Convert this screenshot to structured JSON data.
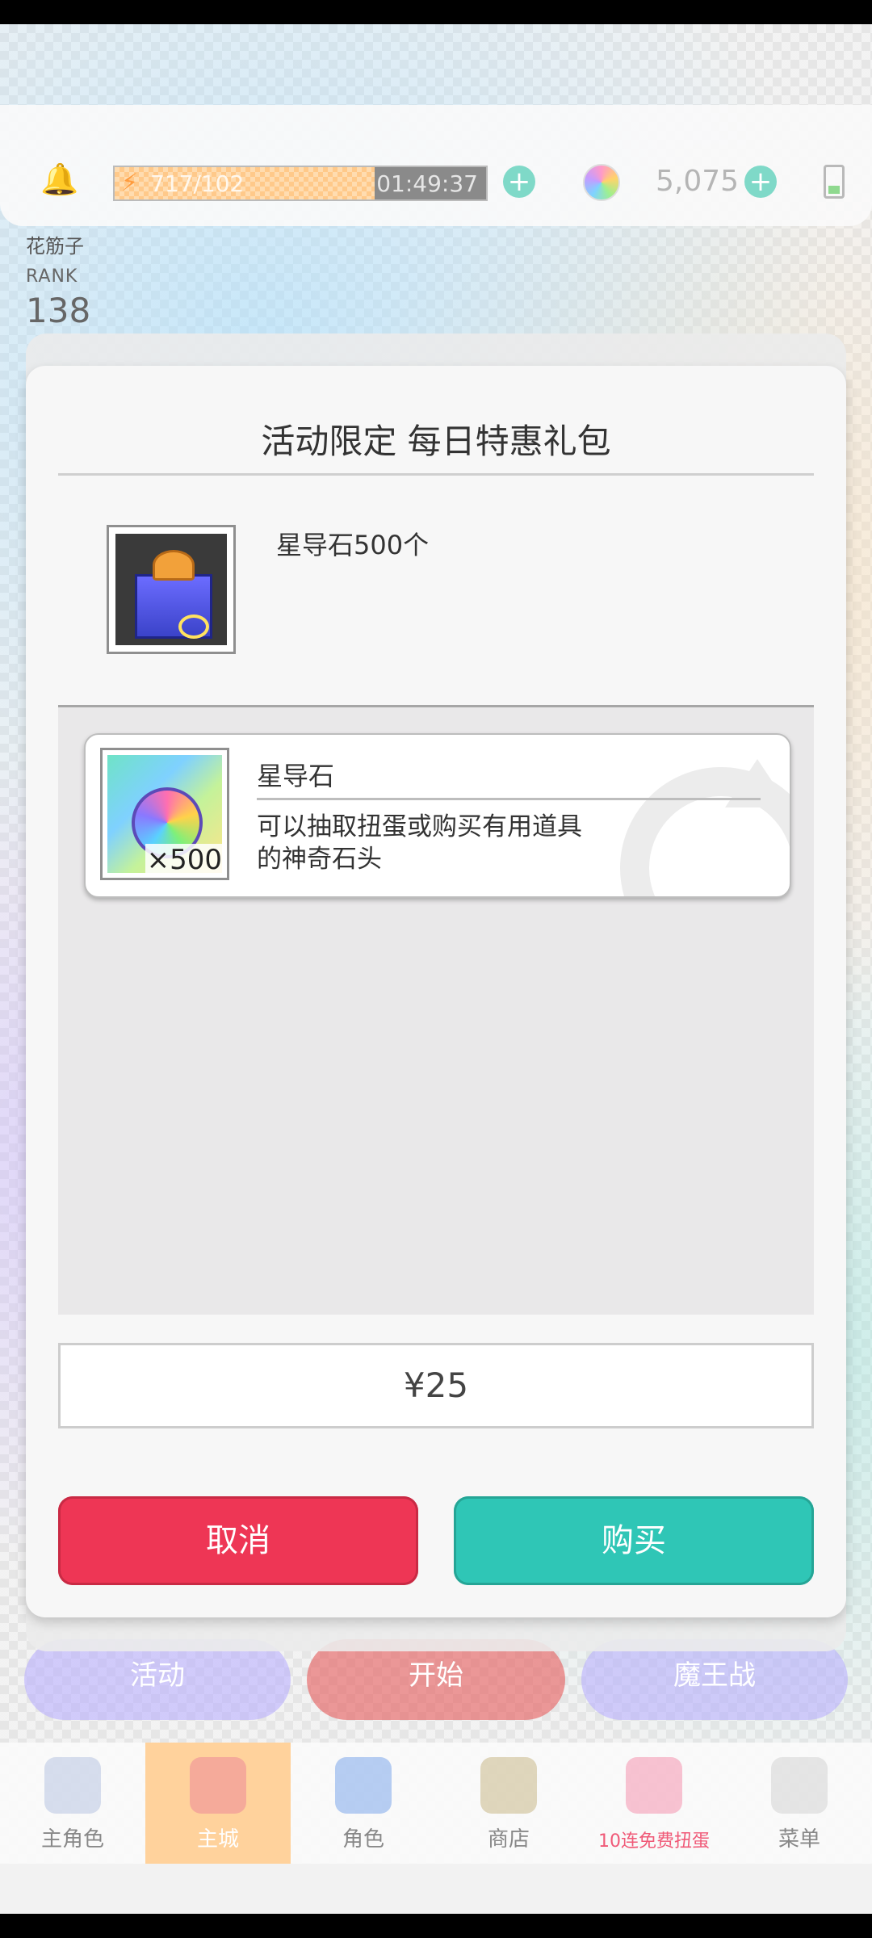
{
  "status": {
    "stamina": "717/102",
    "stamina_timer": "01:49:37",
    "gems": "5,075"
  },
  "player": {
    "name": "花筋子",
    "rank_label": "RANK",
    "rank": "138"
  },
  "dialog": {
    "title": "活动限定 每日特惠礼包",
    "pack_description": "星导石500个",
    "item": {
      "name": "星导石",
      "quantity": "×500",
      "description": "可以抽取扭蛋或购买有用道具的神奇石头"
    },
    "price": "¥25",
    "cancel_label": "取消",
    "buy_label": "购买"
  },
  "bottom_buttons": [
    "活动",
    "开始",
    "魔王战"
  ],
  "nav": [
    {
      "label": "主角色",
      "icon": "hero-icon"
    },
    {
      "label": "主城",
      "icon": "home-icon"
    },
    {
      "label": "角色",
      "icon": "character-icon"
    },
    {
      "label": "商店",
      "icon": "shop-icon"
    },
    {
      "label": "10连免费扭蛋",
      "icon": "gacha-icon"
    },
    {
      "label": "菜单",
      "icon": "menu-icon"
    }
  ],
  "colors": {
    "cancel": "#ee3655",
    "buy": "#2fc6b6",
    "stamina": "#ffc98a"
  }
}
